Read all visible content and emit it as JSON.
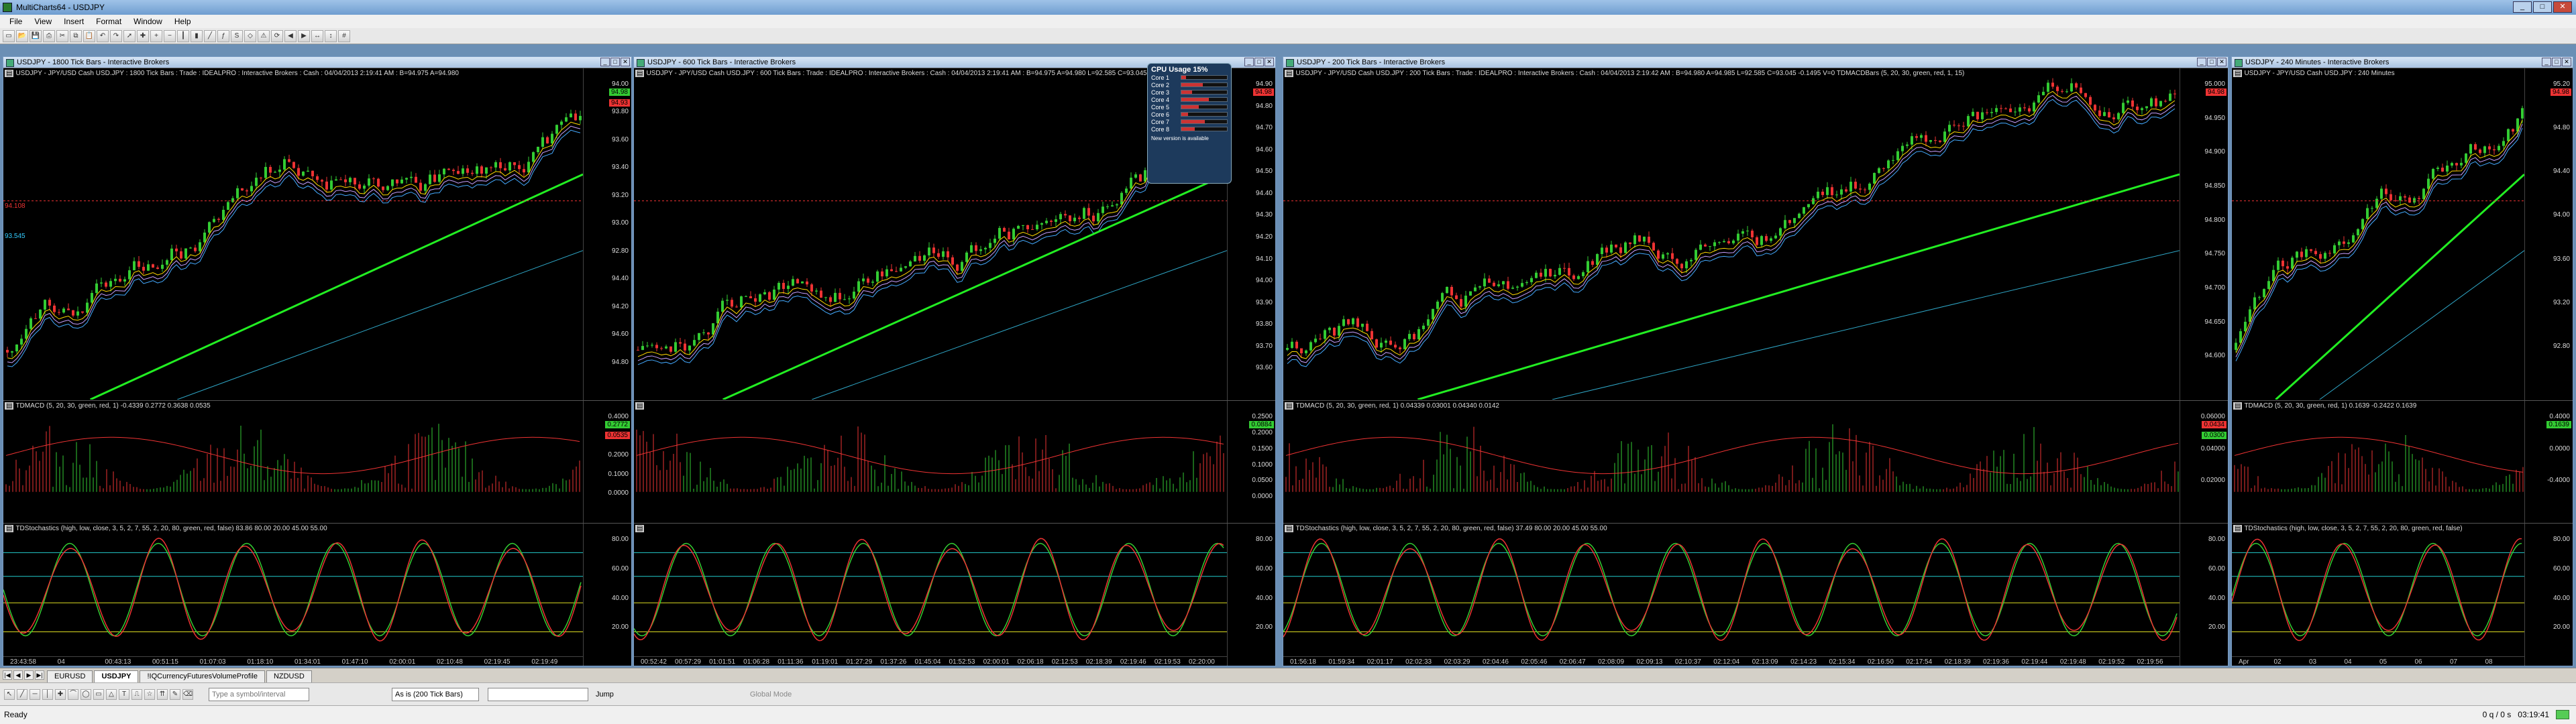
{
  "app": {
    "title": "MultiCharts64 - USDJPY"
  },
  "menu": [
    "File",
    "View",
    "Insert",
    "Format",
    "Window",
    "Help"
  ],
  "toolbar_icons": [
    "new-chart",
    "open",
    "save",
    "print",
    "cut",
    "copy",
    "paste",
    "undo",
    "redo",
    "cursor",
    "crosshair",
    "zoom-in",
    "zoom-out",
    "bar-style",
    "candle-style",
    "line-style",
    "indicators",
    "signals",
    "objects",
    "alerts",
    "refresh",
    "scroll-left",
    "scroll-right",
    "zoom-time",
    "zoom-price",
    "grid"
  ],
  "windows": [
    {
      "title": "USDJPY - 1800 Tick Bars - Interactive Brokers",
      "header": "USDJPY - JPY/USD Cash USD.JPY : 1800 Tick Bars : Trade : IDEALPRO : Interactive Brokers : Cash : 04/04/2013 2:19:41 AM : B=94.975 A=94.980",
      "price_ticks": [
        "94.00",
        "93.80",
        "93.60",
        "93.40",
        "93.20",
        "93.00",
        "92.80",
        "94.40",
        "94.20",
        "94.60",
        "94.80"
      ],
      "price_labels": [
        {
          "text": "94.98",
          "color": "#3c3"
        },
        {
          "text": "94.93",
          "color": "#e33"
        }
      ],
      "side_labels": [
        "94.108",
        "93.545"
      ],
      "ind1_header": "TDMACD (5, 20, 30, green, red, 1) -0.4339  0.2772  0.3638  0.0535",
      "ind1_ticks": [
        "0.4000",
        "0.3000",
        "0.2000",
        "0.1000",
        "0.0000"
      ],
      "ind1_labels": [
        {
          "text": "0.2772",
          "color": "#3c3"
        },
        {
          "text": "0.0535",
          "color": "#e33"
        }
      ],
      "ind2_header": "TDStochastics (high, low, close, 3, 5, 2, 7, 55, 2, 20, 80, green, red, false) 83.86 80.00 20.00 45.00 55.00",
      "ind2_ticks": [
        "80.00",
        "60.00",
        "40.00",
        "20.00"
      ],
      "times": [
        "23:43:58",
        "04",
        "00:43:13",
        "00:51:15",
        "01:07:03",
        "01:18:10",
        "01:34:01",
        "01:47:10",
        "02:00:01",
        "02:10:48",
        "02:19:45",
        "02:19:49"
      ]
    },
    {
      "title": "USDJPY - 600 Tick Bars - Interactive Brokers",
      "header": "USDJPY - JPY/USD Cash USD.JPY : 600 Tick Bars : Trade : IDEALPRO : Interactive Brokers : Cash : 04/04/2013 2:19:41 AM : B=94.975 A=94.980 L=92.585 C=93.045 -0.1495",
      "price_ticks": [
        "94.90",
        "94.80",
        "94.70",
        "94.60",
        "94.50",
        "94.40",
        "94.30",
        "94.20",
        "94.10",
        "94.00",
        "93.90",
        "93.80",
        "93.70",
        "93.60"
      ],
      "price_labels": [
        {
          "text": "94.98",
          "color": "#e33"
        }
      ],
      "side_labels": [],
      "ind1_header": "",
      "ind1_ticks": [
        "0.2500",
        "0.2000",
        "0.1500",
        "0.1000",
        "0.0500",
        "0.0000"
      ],
      "ind1_labels": [
        {
          "text": "0.0884",
          "color": "#3c3"
        }
      ],
      "ind2_header": "",
      "ind2_ticks": [
        "80.00",
        "60.00",
        "40.00",
        "20.00"
      ],
      "times": [
        "00:52:42",
        "00:57:29",
        "01:01:51",
        "01:06:28",
        "01:11:36",
        "01:19:01",
        "01:27:29",
        "01:37:26",
        "01:45:04",
        "01:52:53",
        "02:00:01",
        "02:06:18",
        "02:12:53",
        "02:18:39",
        "02:19:46",
        "02:19:53",
        "02:20:00"
      ]
    },
    {
      "title": "USDJPY - 200 Tick Bars - Interactive Brokers",
      "header": "USDJPY - JPY/USD Cash USD.JPY : 200 Tick Bars : Trade : IDEALPRO : Interactive Brokers : Cash : 04/04/2013 2:19:42 AM : B=94.980 A=94.985 L=92.585 C=93.045 -0.1495  V=0  TDMACDBars (5, 20, 30, green, red, 1, 15)",
      "price_ticks": [
        "95.000",
        "94.950",
        "94.900",
        "94.850",
        "94.800",
        "94.750",
        "94.700",
        "94.650",
        "94.600"
      ],
      "price_labels": [
        {
          "text": "94.98",
          "color": "#e33"
        }
      ],
      "side_labels": [],
      "ind1_header": "TDMACD (5, 20, 30, green, red, 1) 0.04339  0.03001  0.04340  0.0142",
      "ind1_ticks": [
        "0.06000",
        "0.04000",
        "0.02000"
      ],
      "ind1_labels": [
        {
          "text": "0.0434",
          "color": "#e33"
        },
        {
          "text": "0.0300",
          "color": "#3c3"
        }
      ],
      "ind2_header": "TDStochastics (high, low, close, 3, 5, 2, 7, 55, 2, 20, 80, green, red, false) 37.49 80.00 20.00 45.00 55.00",
      "ind2_ticks": [
        "80.00",
        "60.00",
        "40.00",
        "20.00"
      ],
      "times": [
        "01:56:18",
        "01:59:34",
        "02:01:17",
        "02:02:33",
        "02:03:29",
        "02:04:46",
        "02:05:46",
        "02:06:47",
        "02:08:09",
        "02:09:13",
        "02:10:37",
        "02:12:04",
        "02:13:09",
        "02:14:23",
        "02:15:34",
        "02:16:50",
        "02:17:54",
        "02:18:39",
        "02:19:36",
        "02:19:44",
        "02:19:48",
        "02:19:52",
        "02:19:56"
      ]
    },
    {
      "title": "USDJPY - 240 Minutes - Interactive Brokers",
      "header": "USDJPY - JPY/USD Cash USD.JPY : 240 Minutes",
      "price_ticks": [
        "95.20",
        "94.80",
        "94.40",
        "94.00",
        "93.60",
        "93.20",
        "92.80"
      ],
      "price_labels": [
        {
          "text": "94.98",
          "color": "#e33"
        }
      ],
      "side_labels": [],
      "ind1_header": "TDMACD (5, 20, 30, green, red, 1) 0.1639  -0.2422  0.1639",
      "ind1_ticks": [
        "0.4000",
        "0.0000",
        "-0.4000"
      ],
      "ind1_labels": [
        {
          "text": "0.1639",
          "color": "#3c3"
        }
      ],
      "ind2_header": "TDStochastics (high, low, close, 3, 5, 2, 7, 55, 2, 20, 80, green, red, false)",
      "ind2_ticks": [
        "80.00",
        "60.00",
        "40.00",
        "20.00"
      ],
      "times": [
        "Apr",
        "02",
        "03",
        "04",
        "05",
        "06",
        "07",
        "08"
      ]
    }
  ],
  "cpu_widget": {
    "title": "CPU Usage",
    "value": "15%",
    "rows": [
      "Core 1",
      "Core 2",
      "Core 3",
      "Core 4",
      "Core 5",
      "Core 6",
      "Core 7",
      "Core 8"
    ],
    "footer": "New version is available"
  },
  "tabs": {
    "items": [
      "EURUSD",
      "USDJPY",
      "!IQCurrencyFuturesVolumeProfile",
      "NZDUSD"
    ],
    "active": 1
  },
  "bottom": {
    "symbol_placeholder": "Type a symbol/interval",
    "resolution": "As is (200 Tick Bars)",
    "jump": "Jump",
    "global_mode": "Global Mode"
  },
  "status": {
    "left": "Ready",
    "net": "0 q / 0 s",
    "time": "03:19:41"
  },
  "colors": {
    "up": "#3c3",
    "down": "#e33",
    "bg": "#000000",
    "ma_fast": "#ffd800",
    "ma_slow": "#22ee22",
    "ma_long": "#2fa7c7"
  }
}
